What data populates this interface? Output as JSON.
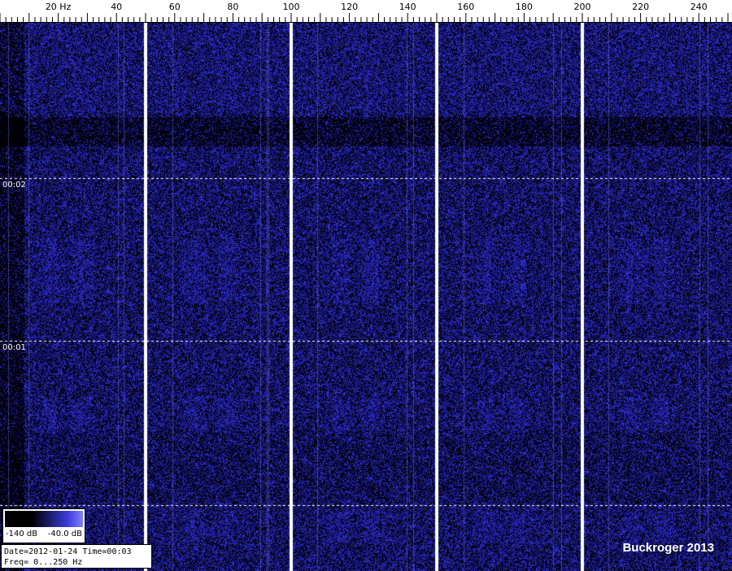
{
  "chart_data": {
    "type": "heatmap",
    "xlabel": "Hz",
    "x_range": [
      0,
      250
    ],
    "x_ticks": [
      {
        "value": 20,
        "label": "20 Hz"
      },
      {
        "value": 40,
        "label": "40"
      },
      {
        "value": 60,
        "label": "60"
      },
      {
        "value": 80,
        "label": "80"
      },
      {
        "value": 100,
        "label": "100"
      },
      {
        "value": 120,
        "label": "120"
      },
      {
        "value": 140,
        "label": "140"
      },
      {
        "value": 160,
        "label": "160"
      },
      {
        "value": 180,
        "label": "180"
      },
      {
        "value": 200,
        "label": "200"
      },
      {
        "value": 220,
        "label": "220"
      },
      {
        "value": 240,
        "label": "240"
      }
    ],
    "time_markers": [
      {
        "label": "00:02"
      },
      {
        "label": "00:01"
      }
    ],
    "colorbar": {
      "min_label": "-140 dB",
      "max_label": "-40.0 dB",
      "colors": [
        "#000000",
        "#3a3ad8",
        "#8080ff"
      ]
    },
    "harmonic_lines_hz": [
      50,
      100,
      150,
      200
    ],
    "info": {
      "date_line": "Date=2012-01-24 Time=00:03",
      "freq_line": "Freq= 0...250 Hz"
    },
    "watermark": "Buckroger 2013",
    "colors": {
      "background": "#000000",
      "signal": "#4848e8",
      "harmonic": "#ffffff",
      "grid": "#ffffff"
    }
  }
}
